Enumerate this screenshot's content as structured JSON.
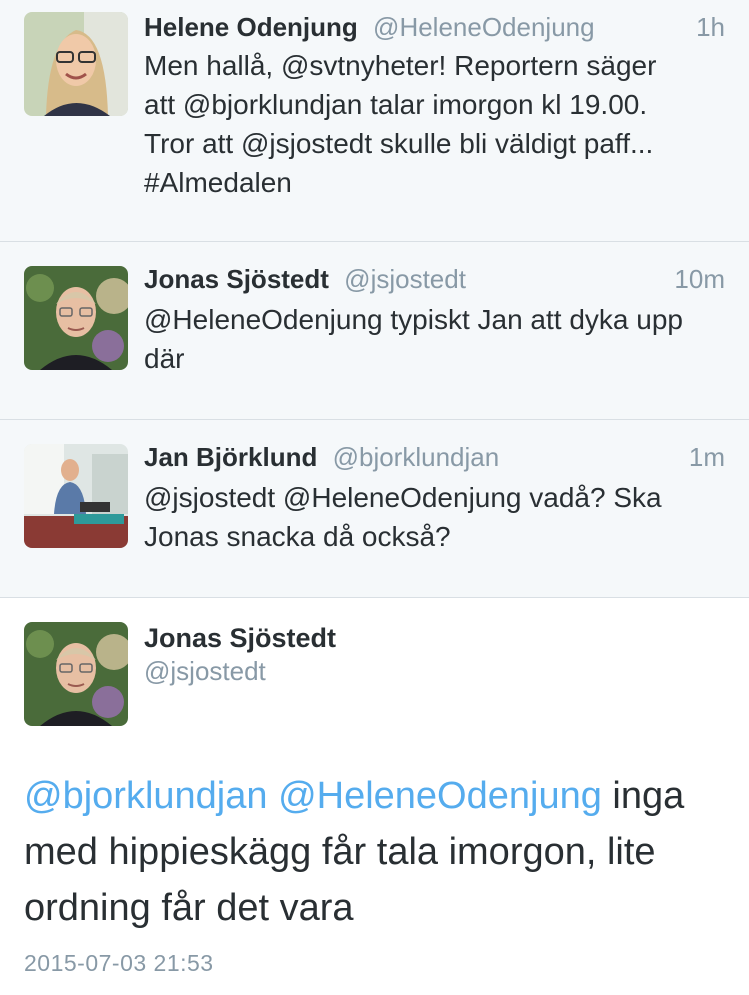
{
  "tweets": [
    {
      "name": "Helene Odenjung",
      "handle": "@HeleneOdenjung",
      "time": "1h",
      "text": "Men hallå, @svtnyheter! Reportern säger\natt @bjorklundjan talar imorgon kl 19.00.\nTror att @jsjostedt skulle bli väldigt paff...\n#Almedalen"
    },
    {
      "name": "Jonas Sjöstedt",
      "handle": "@jsjostedt",
      "time": "10m",
      "text": "@HeleneOdenjung typiskt Jan att dyka upp\ndär"
    },
    {
      "name": "Jan Björklund",
      "handle": "@bjorklundjan",
      "time": "1m",
      "text": "@jsjostedt @HeleneOdenjung vadå? Ska\nJonas snacka då också?"
    }
  ],
  "focused": {
    "name": "Jonas Sjöstedt",
    "handle": "@jsjostedt",
    "mention1": "@bjorklundjan",
    "mention2": "@HeleneOdenjung",
    "text_rest": " inga med hippieskägg får tala imorgon, lite ordning får det vara",
    "timestamp": "2015-07-03 21:53"
  },
  "colors": {
    "link": "#55acee",
    "muted": "#8899a6",
    "text": "#292f33",
    "card_bg": "#f5f8fa"
  },
  "icons": {
    "avatar_helene": "avatar-photo",
    "avatar_jonas": "avatar-photo",
    "avatar_jan": "avatar-photo"
  }
}
